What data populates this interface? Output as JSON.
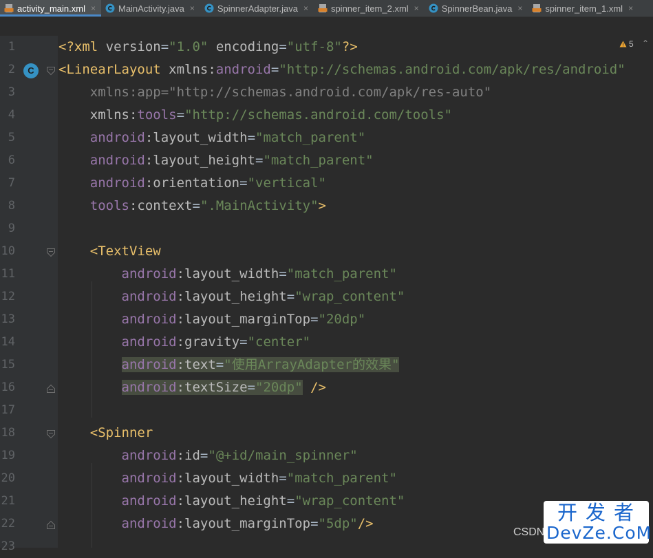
{
  "tabs": [
    {
      "label": "activity_main.xml",
      "icon": "xml-file-icon",
      "active": true
    },
    {
      "label": "MainActivity.java",
      "icon": "java-class-icon",
      "active": false
    },
    {
      "label": "SpinnerAdapter.java",
      "icon": "java-class-icon",
      "active": false
    },
    {
      "label": "spinner_item_2.xml",
      "icon": "xml-file-icon",
      "active": false
    },
    {
      "label": "SpinnerBean.java",
      "icon": "java-class-icon",
      "active": false
    },
    {
      "label": "spinner_item_1.xml",
      "icon": "xml-file-icon",
      "active": false
    }
  ],
  "tab_close_glyph": "×",
  "inspection": {
    "warning_count": "5",
    "chevron": "⌃"
  },
  "gutter": {
    "class_badge": "C"
  },
  "colors": {
    "tag": "#e8bf6a",
    "namespace": "#9876aa",
    "attribute": "#bababa",
    "value": "#6a8759",
    "plain": "#a9b7c6",
    "highlight": "#474d40",
    "accent": "#4a88c7"
  },
  "code_lines": [
    {
      "num": "1",
      "tokens": [
        {
          "t": "<?xml ",
          "c": "tag"
        },
        {
          "t": "version",
          "c": "attr"
        },
        {
          "t": "=",
          "c": "plain"
        },
        {
          "t": "\"1.0\"",
          "c": "val"
        },
        {
          "t": " ",
          "c": "plain"
        },
        {
          "t": "encoding",
          "c": "attr"
        },
        {
          "t": "=",
          "c": "plain"
        },
        {
          "t": "\"utf-8\"",
          "c": "val"
        },
        {
          "t": "?>",
          "c": "tag"
        }
      ]
    },
    {
      "num": "2",
      "fold": "open",
      "tokens": [
        {
          "t": "<LinearLayout ",
          "c": "tag"
        },
        {
          "t": "xmlns:",
          "c": "attr"
        },
        {
          "t": "android",
          "c": "ns"
        },
        {
          "t": "=",
          "c": "plain"
        },
        {
          "t": "\"http://schemas.android.com/apk/res/android\"",
          "c": "val"
        }
      ]
    },
    {
      "num": "3",
      "tokens": [
        {
          "t": "    ",
          "c": "plain"
        },
        {
          "t": "xmlns:app=\"http://schemas.android.com/apk/res-auto\"",
          "c": "dim"
        }
      ]
    },
    {
      "num": "4",
      "tokens": [
        {
          "t": "    ",
          "c": "plain"
        },
        {
          "t": "xmlns:",
          "c": "attr"
        },
        {
          "t": "tools",
          "c": "ns"
        },
        {
          "t": "=",
          "c": "plain"
        },
        {
          "t": "\"http://schemas.android.com/tools\"",
          "c": "val"
        }
      ]
    },
    {
      "num": "5",
      "tokens": [
        {
          "t": "    ",
          "c": "plain"
        },
        {
          "t": "android",
          "c": "ns"
        },
        {
          "t": ":layout_width",
          "c": "attr"
        },
        {
          "t": "=",
          "c": "plain"
        },
        {
          "t": "\"match_parent\"",
          "c": "val"
        }
      ]
    },
    {
      "num": "6",
      "tokens": [
        {
          "t": "    ",
          "c": "plain"
        },
        {
          "t": "android",
          "c": "ns"
        },
        {
          "t": ":layout_height",
          "c": "attr"
        },
        {
          "t": "=",
          "c": "plain"
        },
        {
          "t": "\"match_parent\"",
          "c": "val"
        }
      ]
    },
    {
      "num": "7",
      "tokens": [
        {
          "t": "    ",
          "c": "plain"
        },
        {
          "t": "android",
          "c": "ns"
        },
        {
          "t": ":orientation",
          "c": "attr"
        },
        {
          "t": "=",
          "c": "plain"
        },
        {
          "t": "\"vertical\"",
          "c": "val"
        }
      ]
    },
    {
      "num": "8",
      "tokens": [
        {
          "t": "    ",
          "c": "plain"
        },
        {
          "t": "tools",
          "c": "ns"
        },
        {
          "t": ":context",
          "c": "attr"
        },
        {
          "t": "=",
          "c": "plain"
        },
        {
          "t": "\".MainActivity\"",
          "c": "val"
        },
        {
          "t": ">",
          "c": "tag"
        }
      ]
    },
    {
      "num": "9",
      "tokens": []
    },
    {
      "num": "10",
      "fold": "open",
      "tokens": [
        {
          "t": "    ",
          "c": "plain"
        },
        {
          "t": "<TextView",
          "c": "tag"
        }
      ]
    },
    {
      "num": "11",
      "tokens": [
        {
          "t": "        ",
          "c": "plain"
        },
        {
          "t": "android",
          "c": "ns"
        },
        {
          "t": ":layout_width",
          "c": "attr"
        },
        {
          "t": "=",
          "c": "plain"
        },
        {
          "t": "\"match_parent\"",
          "c": "val"
        }
      ]
    },
    {
      "num": "12",
      "tokens": [
        {
          "t": "        ",
          "c": "plain"
        },
        {
          "t": "android",
          "c": "ns"
        },
        {
          "t": ":layout_height",
          "c": "attr"
        },
        {
          "t": "=",
          "c": "plain"
        },
        {
          "t": "\"wrap_content\"",
          "c": "val"
        }
      ]
    },
    {
      "num": "13",
      "tokens": [
        {
          "t": "        ",
          "c": "plain"
        },
        {
          "t": "android",
          "c": "ns"
        },
        {
          "t": ":layout_marginTop",
          "c": "attr"
        },
        {
          "t": "=",
          "c": "plain"
        },
        {
          "t": "\"20dp\"",
          "c": "val"
        }
      ]
    },
    {
      "num": "14",
      "tokens": [
        {
          "t": "        ",
          "c": "plain"
        },
        {
          "t": "android",
          "c": "ns"
        },
        {
          "t": ":gravity",
          "c": "attr"
        },
        {
          "t": "=",
          "c": "plain"
        },
        {
          "t": "\"center\"",
          "c": "val"
        }
      ]
    },
    {
      "num": "15",
      "tokens": [
        {
          "t": "        ",
          "c": "plain"
        },
        {
          "t": "android",
          "c": "ns",
          "hl": true
        },
        {
          "t": ":text",
          "c": "attr",
          "hl": true
        },
        {
          "t": "=",
          "c": "plain",
          "hl": true
        },
        {
          "t": "\"使用ArrayAdapter的效果\"",
          "c": "val",
          "hl": true
        }
      ]
    },
    {
      "num": "16",
      "fold": "close",
      "tokens": [
        {
          "t": "        ",
          "c": "plain"
        },
        {
          "t": "android",
          "c": "ns",
          "hl": true
        },
        {
          "t": ":textSize",
          "c": "attr",
          "hl": true
        },
        {
          "t": "=",
          "c": "plain",
          "hl": true
        },
        {
          "t": "\"20dp\"",
          "c": "val",
          "hl": true
        },
        {
          "t": " ",
          "c": "plain"
        },
        {
          "t": "/>",
          "c": "tag"
        }
      ]
    },
    {
      "num": "17",
      "tokens": []
    },
    {
      "num": "18",
      "fold": "open",
      "tokens": [
        {
          "t": "    ",
          "c": "plain"
        },
        {
          "t": "<Spinner",
          "c": "tag"
        }
      ]
    },
    {
      "num": "19",
      "tokens": [
        {
          "t": "        ",
          "c": "plain"
        },
        {
          "t": "android",
          "c": "ns"
        },
        {
          "t": ":id",
          "c": "attr"
        },
        {
          "t": "=",
          "c": "plain"
        },
        {
          "t": "\"@+id/main_spinner\"",
          "c": "val"
        }
      ]
    },
    {
      "num": "20",
      "tokens": [
        {
          "t": "        ",
          "c": "plain"
        },
        {
          "t": "android",
          "c": "ns"
        },
        {
          "t": ":layout_width",
          "c": "attr"
        },
        {
          "t": "=",
          "c": "plain"
        },
        {
          "t": "\"match_parent\"",
          "c": "val"
        }
      ]
    },
    {
      "num": "21",
      "tokens": [
        {
          "t": "        ",
          "c": "plain"
        },
        {
          "t": "android",
          "c": "ns"
        },
        {
          "t": ":layout_height",
          "c": "attr"
        },
        {
          "t": "=",
          "c": "plain"
        },
        {
          "t": "\"wrap_content\"",
          "c": "val"
        }
      ]
    },
    {
      "num": "22",
      "fold": "close",
      "tokens": [
        {
          "t": "        ",
          "c": "plain"
        },
        {
          "t": "android",
          "c": "ns"
        },
        {
          "t": ":layout_marginTop",
          "c": "attr"
        },
        {
          "t": "=",
          "c": "plain"
        },
        {
          "t": "\"5dp\"",
          "c": "val"
        },
        {
          "t": "/>",
          "c": "tag"
        }
      ]
    },
    {
      "num": "23",
      "tokens": []
    }
  ],
  "watermark": {
    "csdn": "CSDN",
    "line1": "开发者",
    "line2": "DevZe.CoM"
  }
}
